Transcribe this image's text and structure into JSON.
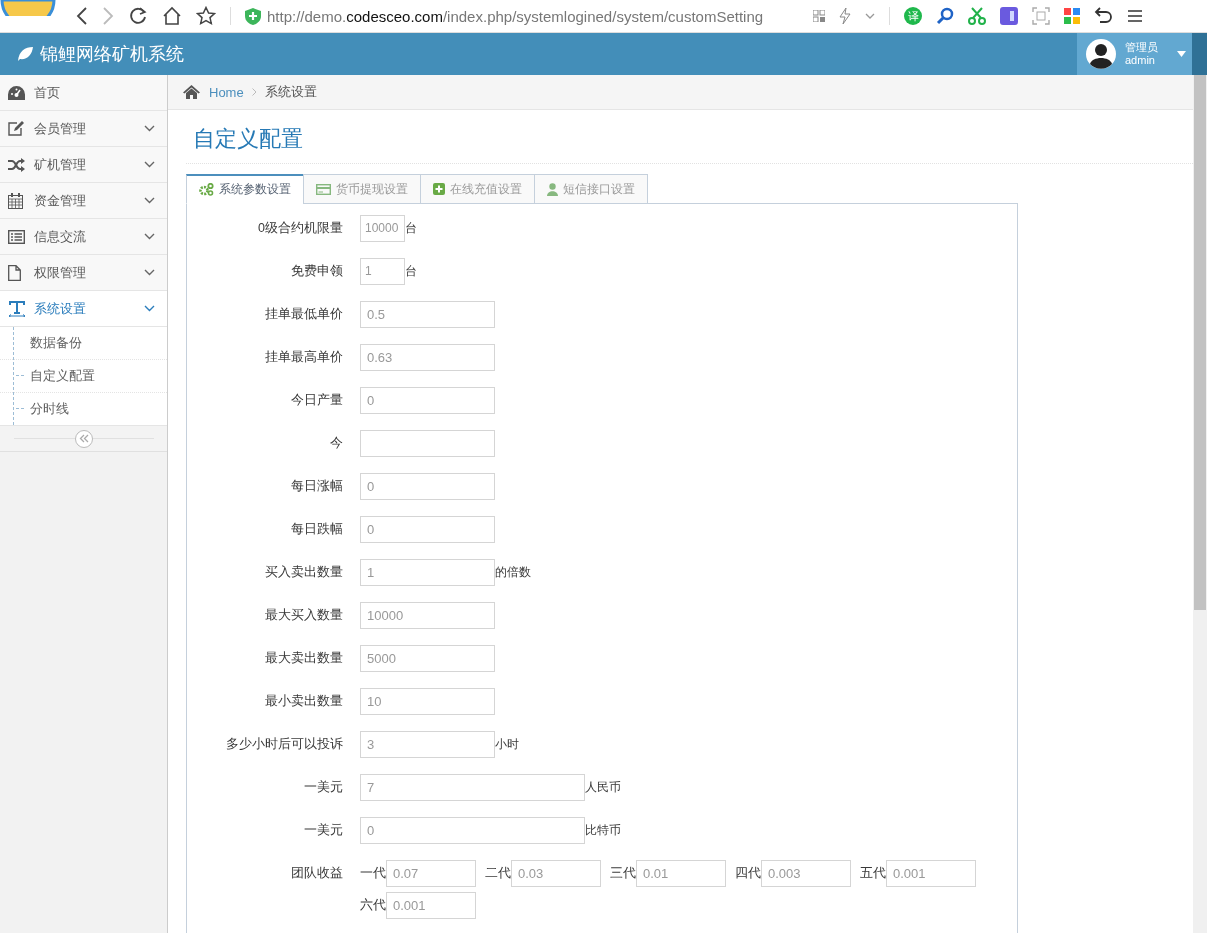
{
  "browser": {
    "url": {
      "prefix": "http://demo.",
      "domain": "codesceo.com",
      "path": "/index.php/systemlogined/system/customSetting"
    },
    "translate_label": "译"
  },
  "app": {
    "title": "锦鲤网络矿机系统",
    "user_role": "管理员",
    "user_name": "admin"
  },
  "sidebar": {
    "items": [
      {
        "label": "首页",
        "kind": "link",
        "selected": false
      },
      {
        "label": "会员管理",
        "kind": "menu",
        "selected": false
      },
      {
        "label": "矿机管理",
        "kind": "menu",
        "selected": false
      },
      {
        "label": "资金管理",
        "kind": "menu",
        "selected": false
      },
      {
        "label": "信息交流",
        "kind": "menu",
        "selected": false
      },
      {
        "label": "权限管理",
        "kind": "menu",
        "selected": false
      },
      {
        "label": "系统设置",
        "kind": "menu",
        "selected": true,
        "children": [
          {
            "label": "数据备份"
          },
          {
            "label": "自定义配置"
          },
          {
            "label": "分时线"
          }
        ]
      }
    ]
  },
  "breadcrumb": [
    {
      "label": "Home",
      "kind": "link"
    },
    {
      "label": "系统设置",
      "kind": "current"
    }
  ],
  "page_title": "自定义配置",
  "tabs": [
    {
      "label": "系统参数设置",
      "selected": true
    },
    {
      "label": "货币提现设置",
      "selected": false
    },
    {
      "label": "在线充值设置",
      "selected": false
    },
    {
      "label": "短信接口设置",
      "selected": false
    }
  ],
  "form": [
    {
      "kind": "narrow",
      "label": "0级合约机限量",
      "value": "10000",
      "suffix": "台"
    },
    {
      "kind": "narrow",
      "label": "免费申领",
      "value": "1",
      "suffix": "台"
    },
    {
      "kind": "medium",
      "label": "挂单最低单价",
      "value": "0.5"
    },
    {
      "kind": "medium",
      "label": "挂单最高单价",
      "value": "0.63"
    },
    {
      "kind": "medium",
      "label": "今日产量",
      "value": "0"
    },
    {
      "kind": "medium",
      "label": "今"
    },
    {
      "kind": "medium",
      "label": "每日涨幅",
      "value": "0"
    },
    {
      "kind": "medium",
      "label": "每日跌幅",
      "value": "0"
    },
    {
      "kind": "medium",
      "label": "买入卖出数量",
      "value": "1",
      "suffix": "的倍数"
    },
    {
      "kind": "medium",
      "label": "最大买入数量",
      "value": "10000"
    },
    {
      "kind": "medium",
      "label": "最大卖出数量",
      "value": "5000"
    },
    {
      "kind": "medium",
      "label": "最小卖出数量",
      "value": "10"
    },
    {
      "kind": "medium",
      "label": "多少小时后可以投诉",
      "value": "3",
      "suffix": "小时"
    },
    {
      "kind": "wide",
      "label": "一美元",
      "value": "7",
      "suffix": "人民币"
    },
    {
      "kind": "wide",
      "label": "一美元",
      "value": "0",
      "suffix": "比特币"
    },
    {
      "kind": "tiers",
      "label": "团队收益",
      "tiers": [
        {
          "label": "一代",
          "value": "0.07"
        },
        {
          "label": "二代",
          "value": "0.03"
        },
        {
          "label": "三代",
          "value": "0.01"
        },
        {
          "label": "四代",
          "value": "0.003"
        },
        {
          "label": "五代",
          "value": "0.001"
        },
        {
          "label": "六代",
          "value": "0.001"
        }
      ]
    }
  ]
}
